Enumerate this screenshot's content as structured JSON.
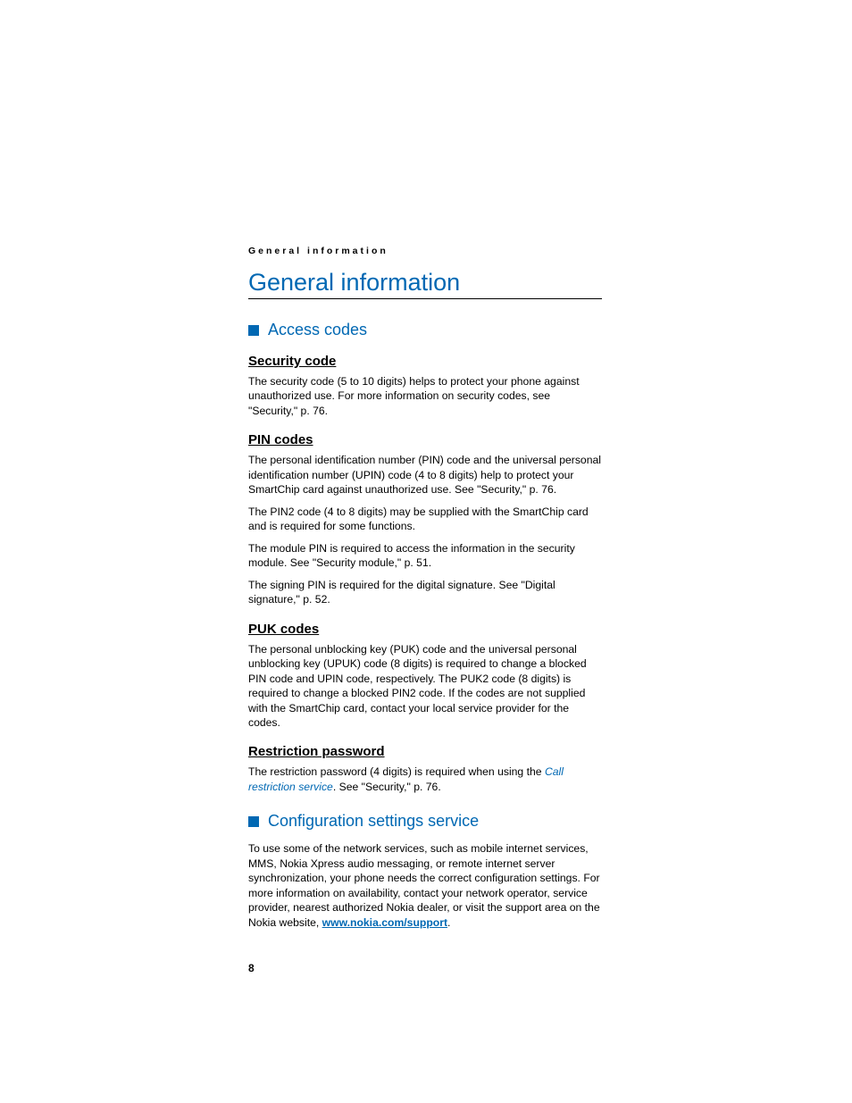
{
  "running_header": "General information",
  "chapter_title": "General information",
  "sections": {
    "access_codes": {
      "title": "Access codes",
      "security_code": {
        "heading": "Security code",
        "p1": "The security code (5 to 10 digits) helps to protect your phone against unauthorized use. For more information on security codes, see \"Security,\" p. 76."
      },
      "pin_codes": {
        "heading": "PIN codes",
        "p1": "The personal identification number (PIN) code and the universal personal identification number (UPIN) code (4 to 8 digits) help to protect your SmartChip card against unauthorized use. See \"Security,\" p. 76.",
        "p2": "The PIN2 code (4 to 8 digits) may be supplied with the SmartChip card and is required for some functions.",
        "p3": "The module PIN is required to access the information in the security module. See \"Security module,\" p. 51.",
        "p4": "The signing PIN is required for the digital signature. See \"Digital signature,\" p. 52."
      },
      "puk_codes": {
        "heading": "PUK codes",
        "p1": "The personal unblocking key (PUK) code and the universal personal unblocking key (UPUK) code (8 digits) is required to change a blocked PIN code and UPIN code, respectively. The PUK2 code (8 digits) is required to change a blocked PIN2 code. If the codes are not supplied with the SmartChip card, contact your local service provider for the codes."
      },
      "restriction_password": {
        "heading": "Restriction password",
        "p1_pre": "The restriction password (4 digits) is required when using the ",
        "link_text": "Call restriction service",
        "p1_post": ". See \"Security,\" p. 76."
      }
    },
    "config_service": {
      "title": "Configuration settings service",
      "p1_pre": "To use some of the network services, such as mobile internet services, MMS, Nokia Xpress audio messaging, or remote internet server synchronization, your phone needs the correct configuration settings. For more information on availability, contact your network operator, service provider, nearest authorized Nokia dealer, or visit the support area on the Nokia website, ",
      "link_text": "www.nokia.com/support",
      "p1_post": "."
    }
  },
  "page_number": "8"
}
